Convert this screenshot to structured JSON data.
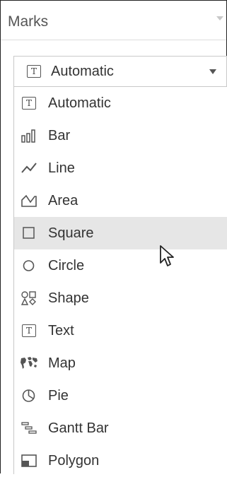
{
  "panel": {
    "title": "Marks"
  },
  "mark_type_dropdown": {
    "selected": "Automatic",
    "icon": "text-t-icon"
  },
  "mark_types": [
    {
      "label": "Automatic",
      "icon": "text-t-icon"
    },
    {
      "label": "Bar",
      "icon": "bar-chart-icon"
    },
    {
      "label": "Line",
      "icon": "line-icon"
    },
    {
      "label": "Area",
      "icon": "area-icon"
    },
    {
      "label": "Square",
      "icon": "square-icon",
      "highlighted": true
    },
    {
      "label": "Circle",
      "icon": "circle-icon"
    },
    {
      "label": "Shape",
      "icon": "shape-icon"
    },
    {
      "label": "Text",
      "icon": "text-t-icon"
    },
    {
      "label": "Map",
      "icon": "map-icon"
    },
    {
      "label": "Pie",
      "icon": "pie-icon"
    },
    {
      "label": "Gantt Bar",
      "icon": "gantt-bar-icon"
    },
    {
      "label": "Polygon",
      "icon": "polygon-icon"
    }
  ],
  "colors": {
    "highlight": "#e6e6e6",
    "text": "#333333",
    "icon": "#555555"
  }
}
